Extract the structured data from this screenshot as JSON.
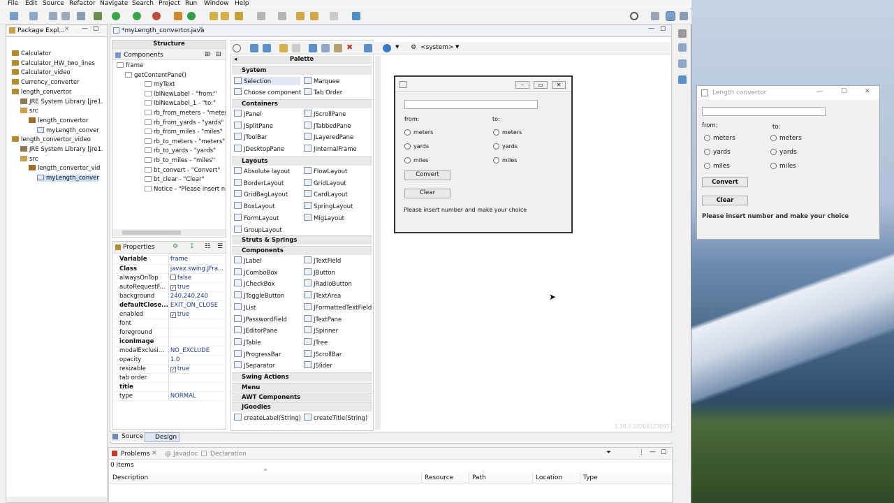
{
  "menu": [
    "File",
    "Edit",
    "Source",
    "Refactor",
    "Navigate",
    "Search",
    "Project",
    "Run",
    "Window",
    "Help"
  ],
  "package_explorer": {
    "tab": "Package Expl...",
    "items": [
      {
        "label": "Calculator",
        "depth": 0,
        "icon": "project"
      },
      {
        "label": "Calculator_HW_two_lines",
        "depth": 0,
        "icon": "project"
      },
      {
        "label": "Calculator_video",
        "depth": 0,
        "icon": "project"
      },
      {
        "label": "Currency_converter",
        "depth": 0,
        "icon": "project"
      },
      {
        "label": "length_convertor",
        "depth": 0,
        "icon": "project"
      },
      {
        "label": "JRE System Library [jre1.",
        "depth": 1,
        "icon": "jre"
      },
      {
        "label": "src",
        "depth": 1,
        "icon": "src"
      },
      {
        "label": "length_convertor",
        "depth": 2,
        "icon": "pkg"
      },
      {
        "label": "myLength_conver",
        "depth": 3,
        "icon": "java"
      },
      {
        "label": "length_convertor_video",
        "depth": 0,
        "icon": "project"
      },
      {
        "label": "JRE System Library [jre1.",
        "depth": 1,
        "icon": "jre"
      },
      {
        "label": "src",
        "depth": 1,
        "icon": "src"
      },
      {
        "label": "length_convertor_vid",
        "depth": 2,
        "icon": "pkg"
      },
      {
        "label": "myLength_conver",
        "depth": 3,
        "icon": "java",
        "selected": true
      }
    ]
  },
  "editor_tab": "*myLength_convertor.java",
  "structure": {
    "title": "Structure",
    "components_label": "Components",
    "items": [
      {
        "label": "frame",
        "depth": 0
      },
      {
        "label": "getContentPane()",
        "depth": 1
      },
      {
        "label": "myText",
        "depth": 2
      },
      {
        "label": "lblNewLabel - \"from:\"",
        "depth": 2
      },
      {
        "label": "lblNewLabel_1 - \"to:\"",
        "depth": 2
      },
      {
        "label": "rb_from_meters - \"meters\"",
        "depth": 2
      },
      {
        "label": "rb_from_yards - \"yards\"",
        "depth": 2
      },
      {
        "label": "rb_from_miles - \"miles\"",
        "depth": 2
      },
      {
        "label": "rb_to_meters - \"meters\"",
        "depth": 2
      },
      {
        "label": "rb_to_yards - \"yards\"",
        "depth": 2
      },
      {
        "label": "rb_to_miles - \"miles\"",
        "depth": 2
      },
      {
        "label": "bt_convert - \"Convert\"",
        "depth": 2
      },
      {
        "label": "bt_clear - \"Clear\"",
        "depth": 2
      },
      {
        "label": "Notice - \"Please insert num",
        "depth": 2
      }
    ]
  },
  "properties": {
    "title": "Properties",
    "rows": [
      [
        "Variable",
        "frame"
      ],
      [
        "Class",
        "javax.swing.JFra..."
      ],
      [
        "alwaysOnTop",
        "false"
      ],
      [
        "autoRequestF...",
        "true"
      ],
      [
        "background",
        "240,240,240"
      ],
      [
        "defaultClose...",
        "EXIT_ON_CLOSE"
      ],
      [
        "enabled",
        "true"
      ],
      [
        "font",
        ""
      ],
      [
        "foreground",
        ""
      ],
      [
        "iconImage",
        ""
      ],
      [
        "modalExclusi...",
        "NO_EXCLUDE"
      ],
      [
        "opacity",
        "1.0"
      ],
      [
        "resizable",
        "true"
      ],
      [
        "tab order",
        ""
      ],
      [
        "title",
        ""
      ],
      [
        "type",
        "NORMAL"
      ]
    ]
  },
  "palette": {
    "title": "Palette",
    "system_combo": "<system>",
    "sections": {
      "system": "System",
      "containers": "Containers",
      "layouts": "Layouts",
      "struts": "Struts & Springs",
      "components": "Components",
      "swing_actions": "Swing Actions",
      "menu": "Menu",
      "awt": "AWT Components",
      "jgoodies": "JGoodies"
    },
    "system_items": [
      "Selection",
      "Marquee",
      "Choose component",
      "Tab Order"
    ],
    "container_items": [
      "JPanel",
      "JScrollPane",
      "JSplitPane",
      "JTabbedPane",
      "JToolBar",
      "JLayeredPane",
      "JDesktopPane",
      "JInternalFrame"
    ],
    "layout_items": [
      "Absolute layout",
      "FlowLayout",
      "BorderLayout",
      "GridLayout",
      "GridBagLayout",
      "CardLayout",
      "BoxLayout",
      "SpringLayout",
      "FormLayout",
      "MigLayout",
      "GroupLayout"
    ],
    "component_items": [
      "JLabel",
      "JTextField",
      "JComboBox",
      "JButton",
      "JCheckBox",
      "JRadioButton",
      "JToggleButton",
      "JTextArea",
      "JList",
      "JFormattedTextField",
      "JPasswordField",
      "JTextPane",
      "JEditorPane",
      "JSpinner",
      "JTable",
      "JTree",
      "JProgressBar",
      "JScrollBar",
      "JSeparator",
      "JSlider"
    ],
    "jgoodies_items": [
      "createLabel(String)",
      "createTitle(String)"
    ]
  },
  "design_form": {
    "from": "from:",
    "to": "to:",
    "meters": "meters",
    "yards": "yards",
    "miles": "miles",
    "convert": "Convert",
    "clear": "Clear",
    "notice": "Please insert number and make your choice"
  },
  "version": "1.10.0.202001230951",
  "bottom_tabs": {
    "source": "Source",
    "design": "Design"
  },
  "problems": {
    "tab": "Problems",
    "javadoc": "Javadoc",
    "declaration": "Declaration",
    "count": "0 items",
    "columns": [
      "Description",
      "Resource",
      "Path",
      "Location",
      "Type"
    ]
  },
  "runtime_window": {
    "title": "Length convertor",
    "from": "from:",
    "to": "to:",
    "meters": "meters",
    "yards": "yards",
    "miles": "miles",
    "convert": "Convert",
    "clear": "Clear",
    "notice": "Please insert number and make your choice"
  }
}
